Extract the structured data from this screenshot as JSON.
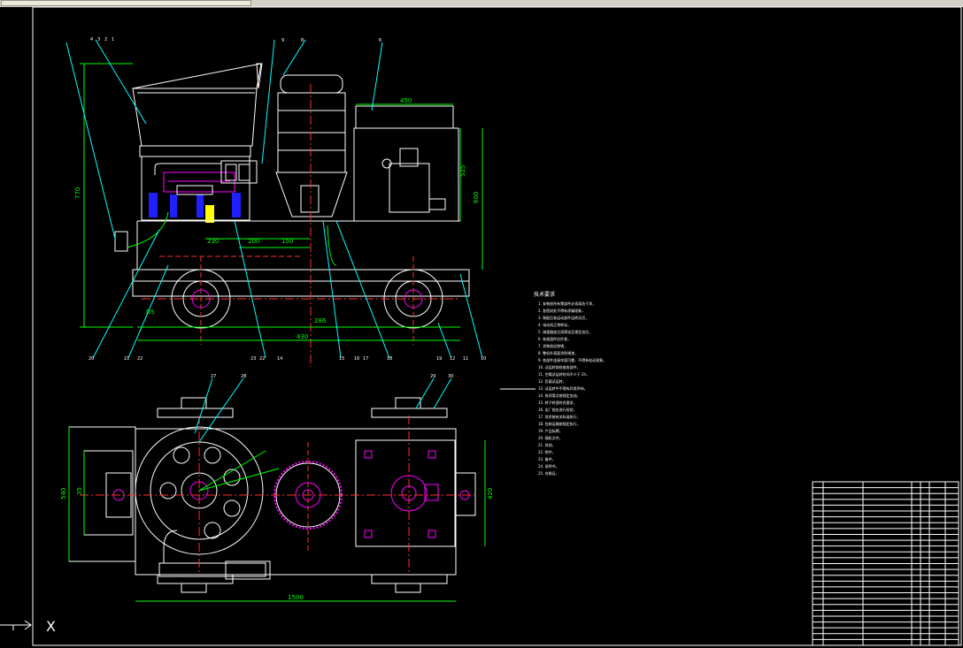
{
  "app": {
    "colors": {
      "background": "#000000",
      "outline": "#ffffff",
      "dimension": "#00ff00",
      "leader": "#00ffff",
      "centerline": "#ff3030",
      "hidden": "#ff00ff",
      "pump": "#2020ff",
      "highlight": "#ffff00"
    }
  },
  "drawing": {
    "front_view": {
      "dims": {
        "height_total": "770",
        "width_450": "450",
        "height_525": "525",
        "height_600": "600",
        "d_230": "230",
        "d_200": "200",
        "d_150": "150",
        "d_286": "286",
        "d_430": "430",
        "d_ds": "DS"
      },
      "balloons_top": [
        "4",
        "3",
        "2",
        "1",
        "9",
        "8",
        "6"
      ],
      "balloons_bottom": [
        "20",
        "21",
        "22",
        "23",
        "22",
        "14",
        "15",
        "16",
        "17",
        "18",
        "19",
        "12",
        "11",
        "10"
      ]
    },
    "top_view": {
      "dims": {
        "width_1500": "1500",
        "height_540": "540",
        "d_35": "35",
        "d_420": "420"
      },
      "balloons": [
        "27",
        "28",
        "29",
        "30"
      ]
    },
    "notes": {
      "heading": "技术要求",
      "lines": [
        "1. 安装前所有零部件必须清洗干净，",
        "2. 各密封处不得有渗漏现象，",
        "3. 装配后各运动部件运转灵活，",
        "4. 电动机正常转动，",
        "5. 减速器加注润滑油至规定油位，",
        "6. 各紧固件应拧紧，",
        "7. 涂装前应除锈，",
        "8. 整机外表面涂防锈漆，",
        "9. 各部件连接牢固可靠，不得有松动现象，",
        "10. 试运转前检查各部件，",
        "11. 空载试运转时间不少于 2h，",
        "12. 负载试运转，",
        "13. 试运转中不得有异常声响，",
        "14. 各润滑点按规定加油，",
        "15. 转子转速符合要求，",
        "16. 出厂前应进行检验，",
        "17. 其余按有关标准执行，",
        "18. 包装运输按规定执行，",
        "19. 产品标牌，",
        "20. 随机文件，",
        "21. 其他，",
        "22. 附件，",
        "23. 备件，",
        "24. 说明书，",
        "25. 合格证，"
      ]
    },
    "title_block_rows": 28
  },
  "command": {
    "axis_label": "X"
  }
}
